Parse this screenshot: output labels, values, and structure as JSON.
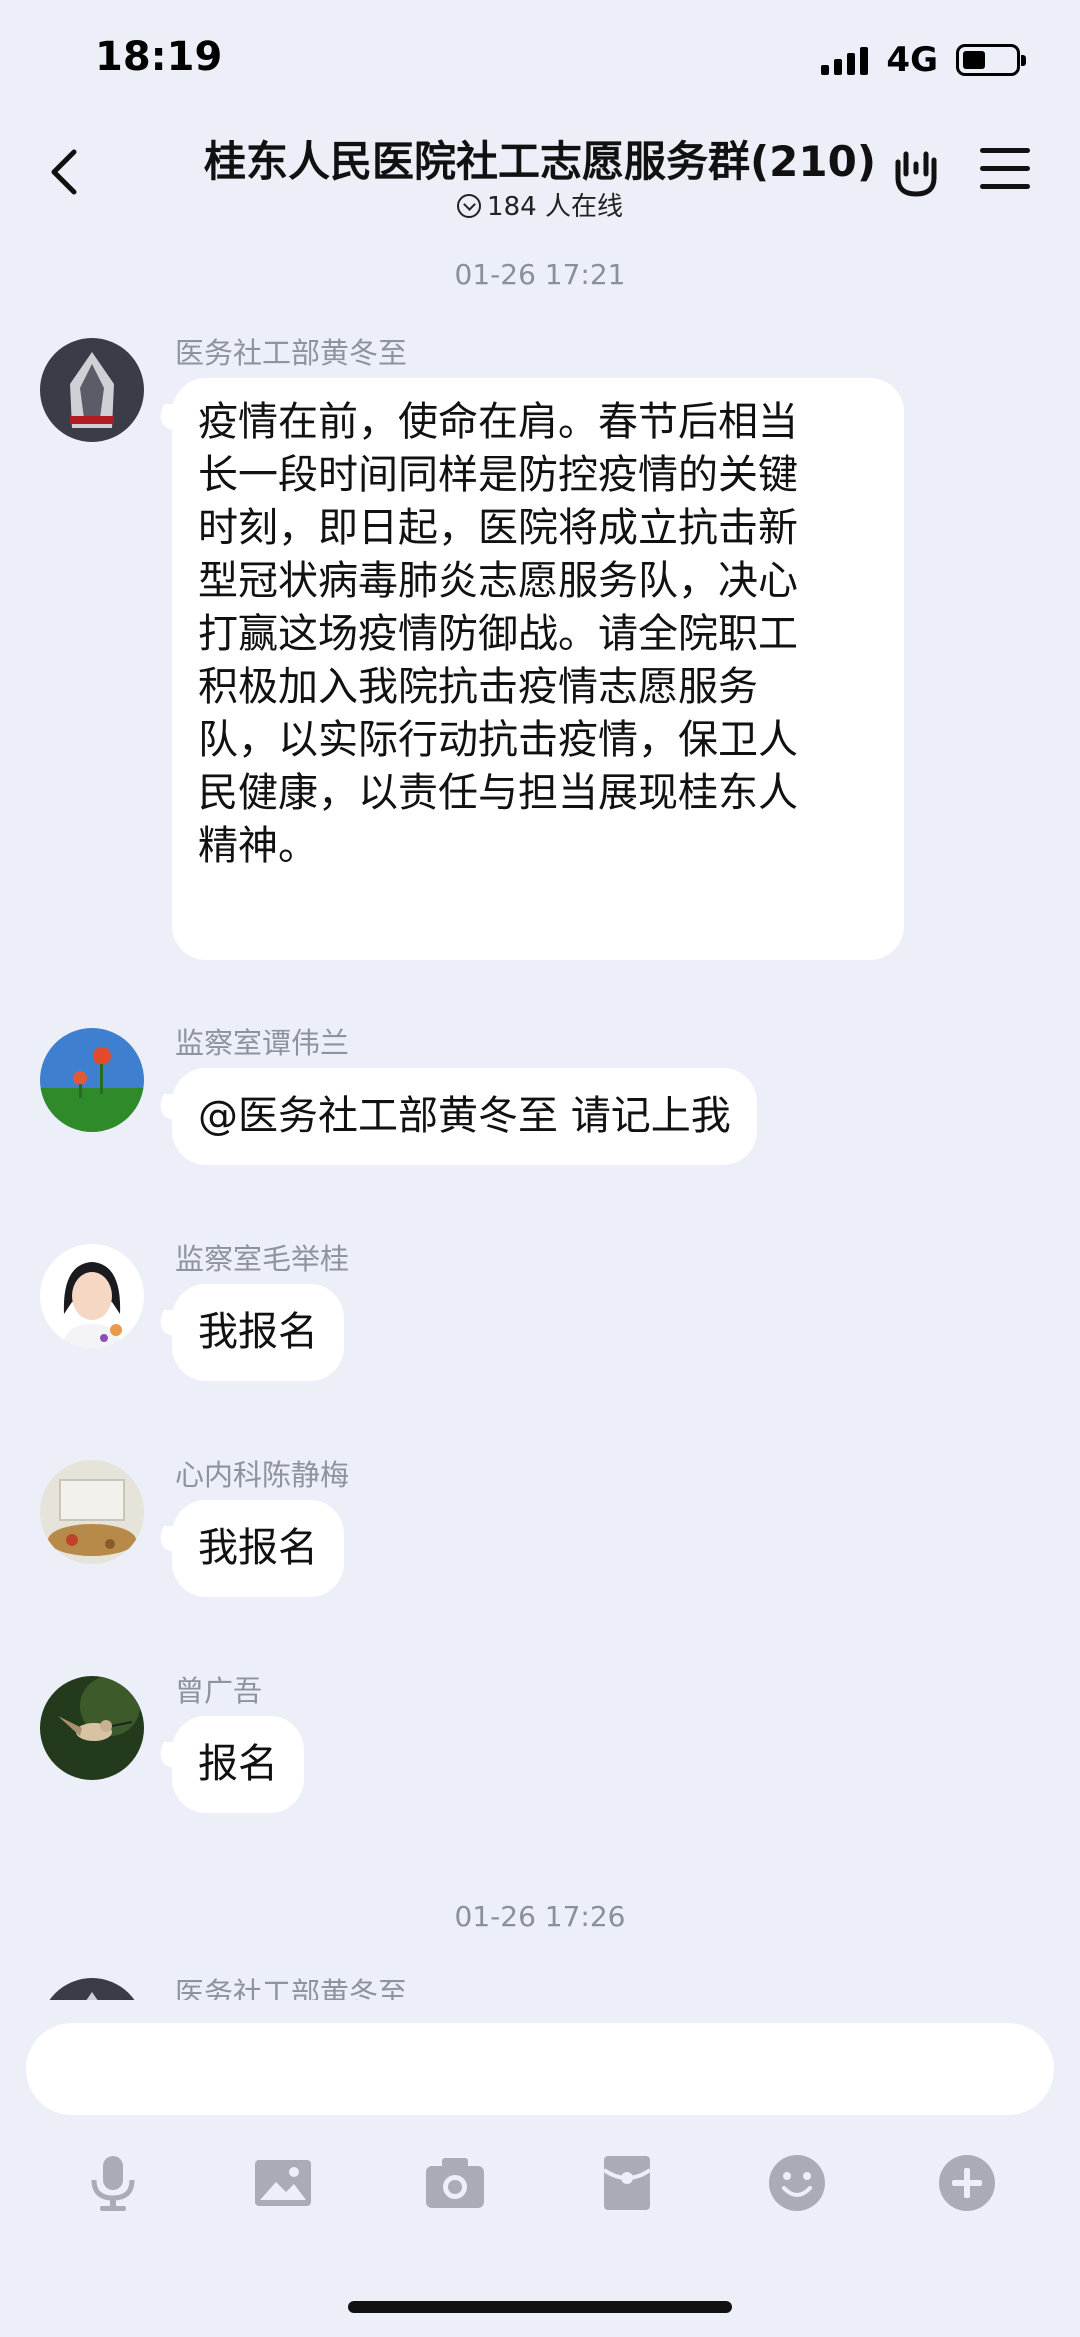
{
  "status_bar": {
    "time": "18:19",
    "network": "4G"
  },
  "header": {
    "title": "桂东人民医院社工志愿服务群(210)",
    "online": "184 人在线"
  },
  "chat": {
    "timestamp_1": "01-26 17:21",
    "messages": [
      {
        "sender": "医务社工部黄冬至",
        "text_lines": [
          "疫情在前，使命在肩。春节后相当",
          "长一段时间同样是防控疫情的关键",
          "时刻，即日起，医院将成立抗击新",
          "型冠状病毒肺炎志愿服务队，决心",
          "打赢这场疫情防御战。请全院职工",
          "积极加入我院抗击疫情志愿服务",
          "队，以实际行动抗击疫情，保卫人",
          "民健康，以责任与担当展现桂东人",
          "精神。"
        ]
      },
      {
        "sender": "监察室谭伟兰",
        "text": "@医务社工部黄冬至 请记上我"
      },
      {
        "sender": "监察室毛举桂",
        "text": "我报名"
      },
      {
        "sender": "心内科陈静梅",
        "text": "我报名"
      },
      {
        "sender": "曾广吾",
        "text": "报名"
      }
    ],
    "timestamp_2": "01-26 17:26",
    "partial_sender": "医务社工部黄冬至"
  },
  "input": {
    "placeholder": ""
  },
  "toolbar": {
    "items": [
      "microphone-icon",
      "image-icon",
      "camera-icon",
      "red-packet-icon",
      "emoji-icon",
      "plus-icon"
    ]
  }
}
